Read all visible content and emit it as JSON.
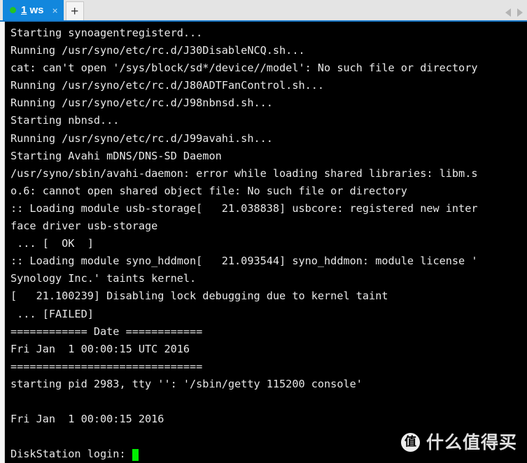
{
  "window": {
    "tabs": [
      {
        "status_dot_color": "#24c424",
        "number": "1",
        "name": "ws",
        "close_label": "×"
      }
    ],
    "new_tab_label": "+",
    "nav_prev_label": "◀",
    "nav_next_label": "▶",
    "accent_color": "#1287dd",
    "chrome_color": "#e4e4e4"
  },
  "terminal": {
    "background_color": "#000000",
    "foreground_color": "#e8e8e8",
    "cursor_color": "#00ee00",
    "lines": [
      "Starting synoagentregisterd...",
      "Running /usr/syno/etc/rc.d/J30DisableNCQ.sh...",
      "cat: can't open '/sys/block/sd*/device//model': No such file or directory",
      "Running /usr/syno/etc/rc.d/J80ADTFanControl.sh...",
      "Running /usr/syno/etc/rc.d/J98nbnsd.sh...",
      "Starting nbnsd...",
      "Running /usr/syno/etc/rc.d/J99avahi.sh...",
      "Starting Avahi mDNS/DNS-SD Daemon",
      "/usr/syno/sbin/avahi-daemon: error while loading shared libraries: libm.s",
      "o.6: cannot open shared object file: No such file or directory",
      ":: Loading module usb-storage[   21.038838] usbcore: registered new inter",
      "face driver usb-storage",
      " ... [  OK  ]",
      ":: Loading module syno_hddmon[   21.093544] syno_hddmon: module license '",
      "Synology Inc.' taints kernel.",
      "[   21.100239] Disabling lock debugging due to kernel taint",
      " ... [FAILED]",
      "============ Date ============",
      "Fri Jan  1 00:00:15 UTC 2016",
      "==============================",
      "starting pid 2983, tty '': '/sbin/getty 115200 console'",
      "",
      "Fri Jan  1 00:00:15 2016",
      "",
      "DiskStation login: "
    ]
  },
  "watermark": {
    "logo_char": "值",
    "text": "什么值得买"
  }
}
